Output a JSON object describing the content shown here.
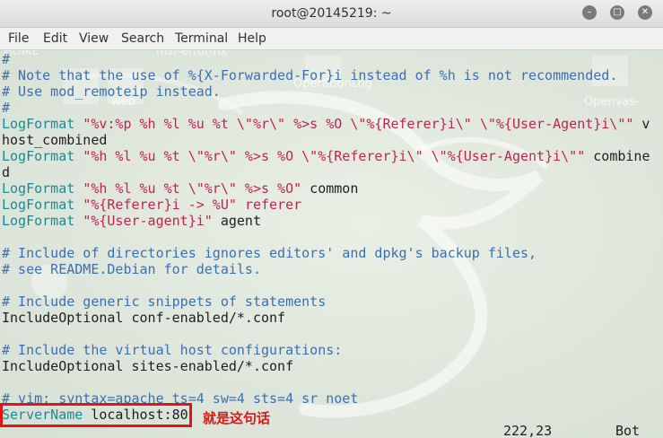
{
  "window": {
    "title": "root@20145219: ~"
  },
  "menu": [
    "File",
    "Edit",
    "View",
    "Search",
    "Terminal",
    "Help"
  ],
  "desktop_labels": [
    "msf-error-fix",
    "HOME",
    "web",
    "OperationLog",
    "Openvas-"
  ],
  "lines": [
    [
      [
        "c",
        "#"
      ]
    ],
    [
      [
        "c",
        "# Note that the use of %{X-Forwarded-For}i instead of %h is not recommended."
      ]
    ],
    [
      [
        "c",
        "# Use mod_remoteip instead."
      ]
    ],
    [
      [
        "c",
        "#"
      ]
    ],
    [
      [
        "d",
        "LogFormat"
      ],
      [
        "t",
        " "
      ],
      [
        "s",
        "\"%v:%p %h %l %u %t \\\"%r\\\" %>s %O \\\"%{Referer}i\\\" \\\"%{User-Agent}i\\\"\""
      ],
      [
        "t",
        " v"
      ]
    ],
    [
      [
        "t",
        "host_combined"
      ]
    ],
    [
      [
        "d",
        "LogFormat"
      ],
      [
        "t",
        " "
      ],
      [
        "s",
        "\"%h %l %u %t \\\"%r\\\" %>s %O \\\"%{Referer}i\\\" \\\"%{User-Agent}i\\\"\""
      ],
      [
        "t",
        " combine"
      ]
    ],
    [
      [
        "t",
        "d"
      ]
    ],
    [
      [
        "d",
        "LogFormat"
      ],
      [
        "t",
        " "
      ],
      [
        "s",
        "\"%h %l %u %t \\\"%r\\\" %>s %O\""
      ],
      [
        "t",
        " common"
      ]
    ],
    [
      [
        "d",
        "LogFormat"
      ],
      [
        "t",
        " "
      ],
      [
        "s",
        "\"%{Referer}i -> %U\""
      ],
      [
        "t",
        " "
      ],
      [
        "s",
        "referer"
      ]
    ],
    [
      [
        "d",
        "LogFormat"
      ],
      [
        "t",
        " "
      ],
      [
        "s",
        "\"%{User-agent}i\""
      ],
      [
        "t",
        " agent"
      ]
    ],
    [
      [
        "t",
        ""
      ]
    ],
    [
      [
        "c",
        "# Include of directories ignores editors' and dpkg's backup files,"
      ]
    ],
    [
      [
        "c",
        "# see README.Debian for details."
      ]
    ],
    [
      [
        "t",
        ""
      ]
    ],
    [
      [
        "c",
        "# Include generic snippets of statements"
      ]
    ],
    [
      [
        "t",
        "IncludeOptional conf-enabled/*.conf"
      ]
    ],
    [
      [
        "t",
        ""
      ]
    ],
    [
      [
        "c",
        "# Include the virtual host configurations:"
      ]
    ],
    [
      [
        "t",
        "IncludeOptional sites-enabled/*.conf"
      ]
    ],
    [
      [
        "t",
        ""
      ]
    ],
    [
      [
        "c",
        "# vim: syntax=apache ts=4 sw=4 sts=4 sr noet"
      ]
    ],
    [
      [
        "d",
        "ServerName"
      ],
      [
        "t",
        " localhost:80"
      ]
    ]
  ],
  "annotation": "就是这句话",
  "status": {
    "cursor": "222,23",
    "position": "Bot"
  },
  "colors": {
    "comment": "#3b6fb6",
    "directive": "#1c8a96",
    "string": "#c2244a",
    "highlight": "#e01616"
  }
}
